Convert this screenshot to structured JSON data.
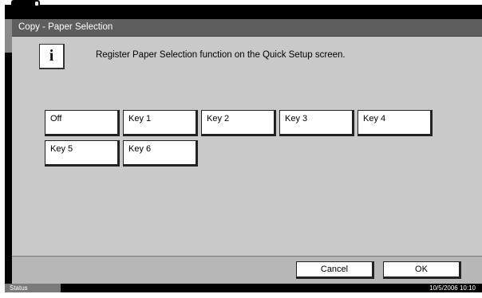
{
  "window": {
    "title": "Copy - Paper Selection"
  },
  "info": {
    "icon": "info-icon",
    "message": "Register Paper Selection function on the Quick Setup screen."
  },
  "keys": [
    "Off",
    "Key 1",
    "Key 2",
    "Key 3",
    "Key 4",
    "Key 5",
    "Key 6"
  ],
  "footer": {
    "cancel_label": "Cancel",
    "ok_label": "OK"
  },
  "statusbar": {
    "status_label": "Status",
    "datetime": "10/5/2006   10:10"
  }
}
